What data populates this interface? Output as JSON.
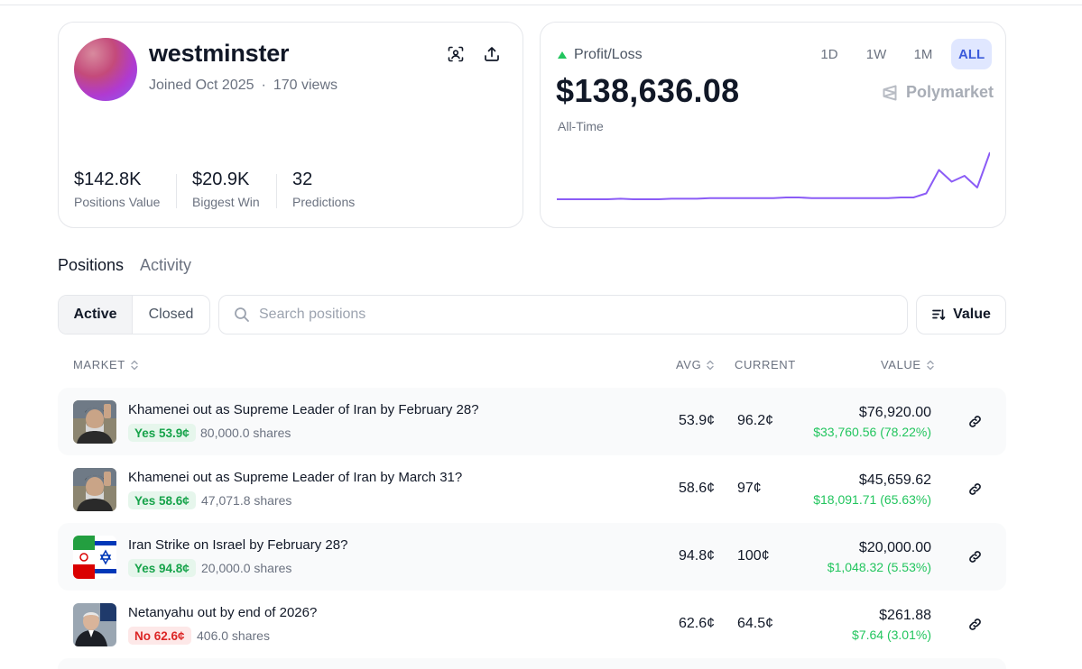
{
  "profile": {
    "username": "westminster",
    "joined": "Joined Oct 2025",
    "views": "170 views",
    "stats": [
      {
        "value": "$142.8K",
        "label": "Positions Value"
      },
      {
        "value": "$20.9K",
        "label": "Biggest Win"
      },
      {
        "value": "32",
        "label": "Predictions"
      }
    ]
  },
  "pnl": {
    "label": "Profit/Loss",
    "amount": "$138,636.08",
    "period": "All-Time",
    "ranges": [
      "1D",
      "1W",
      "1M",
      "ALL"
    ],
    "active_range": "ALL",
    "brand": "Polymarket",
    "line_color": "#8b5cf6",
    "series": [
      0.2,
      0.2,
      0.2,
      0.2,
      0.2,
      0.21,
      0.2,
      0.2,
      0.2,
      0.21,
      0.21,
      0.21,
      0.22,
      0.22,
      0.22,
      0.22,
      0.22,
      0.22,
      0.23,
      0.23,
      0.22,
      0.22,
      0.22,
      0.22,
      0.22,
      0.22,
      0.22,
      0.23,
      0.23,
      0.3,
      0.7,
      0.5,
      0.6,
      0.4,
      1.0
    ]
  },
  "tabs": {
    "positions": "Positions",
    "activity": "Activity"
  },
  "filter": {
    "active": "Active",
    "closed": "Closed"
  },
  "search": {
    "placeholder": "Search positions"
  },
  "sort": {
    "label": "Value"
  },
  "columns": {
    "market": "MARKET",
    "avg": "AVG",
    "current": "CURRENT",
    "value": "VALUE"
  },
  "positions": [
    {
      "title": "Khamenei out as Supreme Leader of Iran by February 28?",
      "outcome": "Yes 53.9¢",
      "shares": "80,000.0 shares",
      "avg": "53.9¢",
      "current": "96.2¢",
      "value": "$76,920.00",
      "pnl": "$33,760.56 (78.22%)"
    },
    {
      "title": "Khamenei out as Supreme Leader of Iran by March 31?",
      "outcome": "Yes 58.6¢",
      "shares": "47,071.8 shares",
      "avg": "58.6¢",
      "current": "97¢",
      "value": "$45,659.62",
      "pnl": "$18,091.71 (65.63%)"
    },
    {
      "title": "Iran Strike on Israel by February 28?",
      "outcome": "Yes 94.8¢",
      "shares": "20,000.0 shares",
      "avg": "94.8¢",
      "current": "100¢",
      "value": "$20,000.00",
      "pnl": "$1,048.32 (5.53%)"
    },
    {
      "title": "Netanyahu out by end of 2026?",
      "outcome": "No 62.6¢",
      "shares": "406.0 shares",
      "avg": "62.6¢",
      "current": "64.5¢",
      "value": "$261.88",
      "pnl": "$7.64 (3.01%)"
    }
  ]
}
